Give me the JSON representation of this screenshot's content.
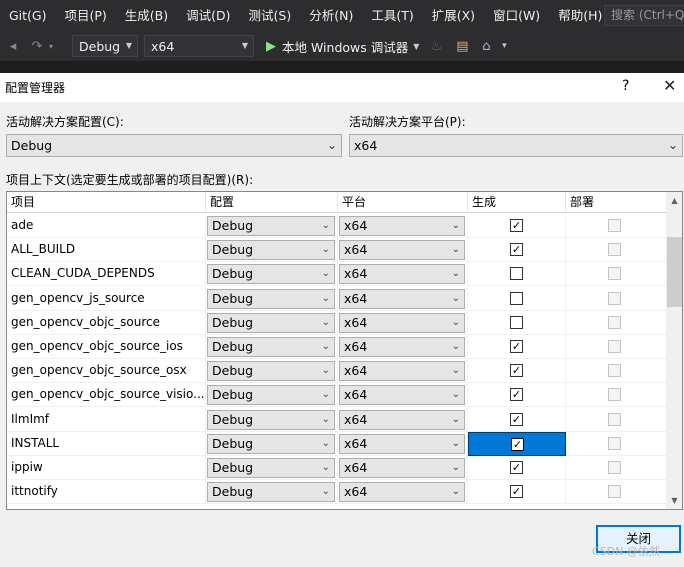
{
  "menu": {
    "items": [
      "Git(G)",
      "项目(P)",
      "生成(B)",
      "调试(D)",
      "测试(S)",
      "分析(N)",
      "工具(T)",
      "扩展(X)",
      "窗口(W)",
      "帮助(H)"
    ],
    "search_placeholder": "搜索 (Ctrl+Q)"
  },
  "toolbar": {
    "configuration": "Debug",
    "platform": "x64",
    "run_label": "本地 Windows 调试器"
  },
  "dialog": {
    "title": "配置管理器",
    "help_label": "?",
    "active_config_label": "活动解决方案配置(C):",
    "active_config_value": "Debug",
    "active_platform_label": "活动解决方案平台(P):",
    "active_platform_value": "x64",
    "project_context_label": "项目上下文(选定要生成或部署的项目配置)(R):",
    "columns": [
      "项目",
      "配置",
      "平台",
      "生成",
      "部署"
    ],
    "rows": [
      {
        "project": "ade",
        "config": "Debug",
        "platform": "x64",
        "build": true,
        "deploy": false
      },
      {
        "project": "ALL_BUILD",
        "config": "Debug",
        "platform": "x64",
        "build": true,
        "deploy": false
      },
      {
        "project": "CLEAN_CUDA_DEPENDS",
        "config": "Debug",
        "platform": "x64",
        "build": false,
        "deploy": false
      },
      {
        "project": "gen_opencv_js_source",
        "config": "Debug",
        "platform": "x64",
        "build": false,
        "deploy": false
      },
      {
        "project": "gen_opencv_objc_source",
        "config": "Debug",
        "platform": "x64",
        "build": false,
        "deploy": false
      },
      {
        "project": "gen_opencv_objc_source_ios",
        "config": "Debug",
        "platform": "x64",
        "build": true,
        "deploy": false
      },
      {
        "project": "gen_opencv_objc_source_osx",
        "config": "Debug",
        "platform": "x64",
        "build": true,
        "deploy": false
      },
      {
        "project": "gen_opencv_objc_source_visio...",
        "config": "Debug",
        "platform": "x64",
        "build": true,
        "deploy": false
      },
      {
        "project": "IlmImf",
        "config": "Debug",
        "platform": "x64",
        "build": true,
        "deploy": false
      },
      {
        "project": "INSTALL",
        "config": "Debug",
        "platform": "x64",
        "build": true,
        "deploy": false,
        "selected": true
      },
      {
        "project": "ippiw",
        "config": "Debug",
        "platform": "x64",
        "build": true,
        "deploy": false
      },
      {
        "project": "ittnotify",
        "config": "Debug",
        "platform": "x64",
        "build": true,
        "deploy": false
      }
    ],
    "close_label": "关闭"
  },
  "watermark": "CSDN @依然",
  "colors": {
    "selection": "#0078d7",
    "toolbar_bg": "#2d2d30",
    "dialog_bg": "#f0f0f0"
  }
}
